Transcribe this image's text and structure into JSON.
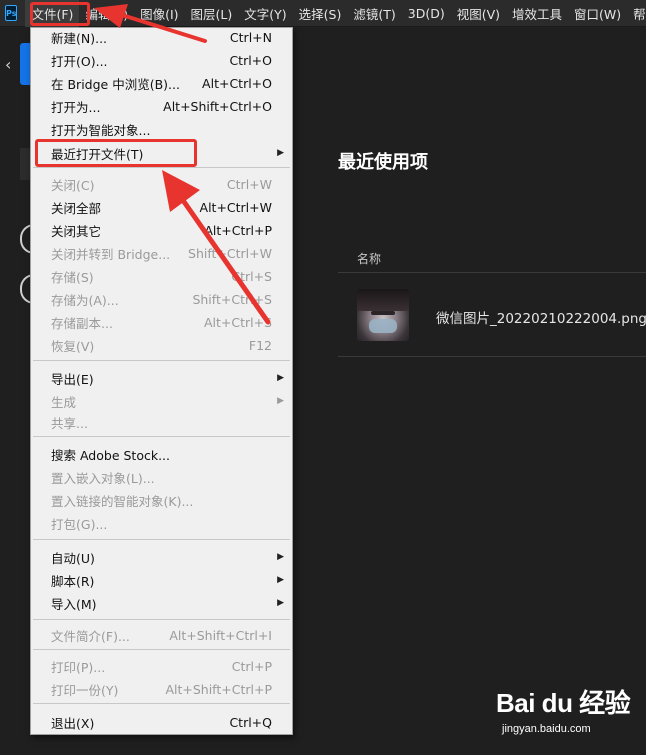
{
  "menubar": {
    "logo": "Ps",
    "items": [
      "文件(F)",
      "编辑(E)",
      "图像(I)",
      "图层(L)",
      "文字(Y)",
      "选择(S)",
      "滤镜(T)",
      "3D(D)",
      "视图(V)",
      "增效工具",
      "窗口(W)",
      "帮"
    ]
  },
  "home": {
    "recent_title": "最近使用项",
    "name_header": "名称",
    "recent_file": "微信图片_20220210222004.png"
  },
  "file_menu": {
    "new": {
      "label": "新建(N)...",
      "shortcut": "Ctrl+N"
    },
    "open": {
      "label": "打开(O)...",
      "shortcut": "Ctrl+O"
    },
    "browse_bridge": {
      "label": "在 Bridge 中浏览(B)...",
      "shortcut": "Alt+Ctrl+O"
    },
    "open_as": {
      "label": "打开为...",
      "shortcut": "Alt+Shift+Ctrl+O"
    },
    "open_smart": {
      "label": "打开为智能对象..."
    },
    "open_recent": {
      "label": "最近打开文件(T)"
    },
    "close": {
      "label": "关闭(C)",
      "shortcut": "Ctrl+W"
    },
    "close_all": {
      "label": "关闭全部",
      "shortcut": "Alt+Ctrl+W"
    },
    "close_others": {
      "label": "关闭其它",
      "shortcut": "Alt+Ctrl+P"
    },
    "close_bridge": {
      "label": "关闭并转到 Bridge...",
      "shortcut": "Shift+Ctrl+W"
    },
    "save": {
      "label": "存储(S)",
      "shortcut": "Ctrl+S"
    },
    "save_as": {
      "label": "存储为(A)...",
      "shortcut": "Shift+Ctrl+S"
    },
    "save_copy": {
      "label": "存储副本...",
      "shortcut": "Alt+Ctrl+S"
    },
    "revert": {
      "label": "恢复(V)",
      "shortcut": "F12"
    },
    "export": {
      "label": "导出(E)"
    },
    "generate": {
      "label": "生成"
    },
    "share": {
      "label": "共享..."
    },
    "search_stock": {
      "label": "搜索 Adobe Stock..."
    },
    "place_embedded": {
      "label": "置入嵌入对象(L)..."
    },
    "place_linked": {
      "label": "置入链接的智能对象(K)..."
    },
    "package": {
      "label": "打包(G)..."
    },
    "automate": {
      "label": "自动(U)"
    },
    "scripts": {
      "label": "脚本(R)"
    },
    "import": {
      "label": "导入(M)"
    },
    "file_info": {
      "label": "文件简介(F)...",
      "shortcut": "Alt+Shift+Ctrl+I"
    },
    "print": {
      "label": "打印(P)...",
      "shortcut": "Ctrl+P"
    },
    "print_one": {
      "label": "打印一份(Y)",
      "shortcut": "Alt+Shift+Ctrl+P"
    },
    "exit": {
      "label": "退出(X)",
      "shortcut": "Ctrl+Q"
    }
  },
  "watermark": {
    "logo": "Bai du 经验",
    "url": "jingyan.baidu.com"
  },
  "colors": {
    "annotation": "#e8342f",
    "menu_bg": "#f0f0f0",
    "app_bg": "#1f1f1f"
  }
}
